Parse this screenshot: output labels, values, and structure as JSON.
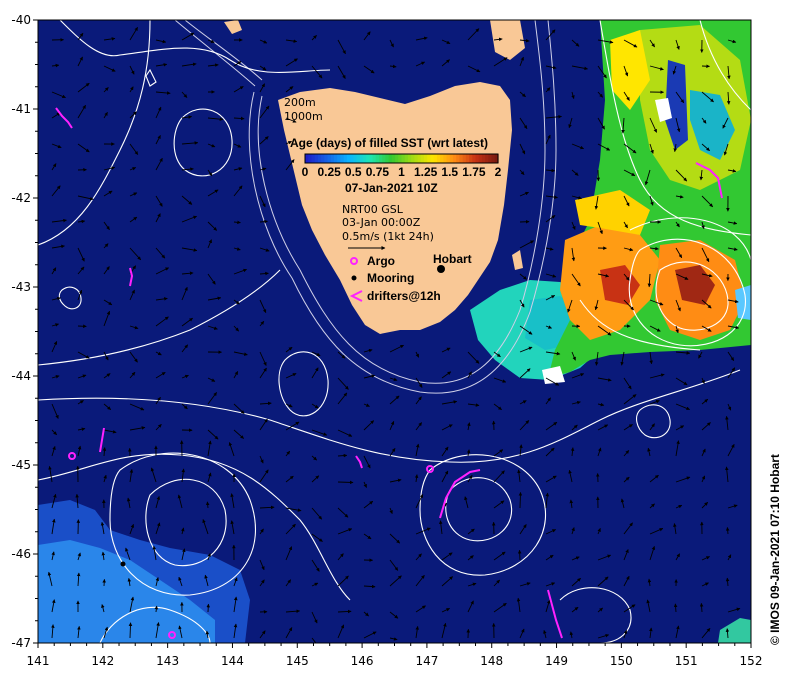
{
  "map": {
    "lon_ticks": [
      "141",
      "142",
      "143",
      "144",
      "145",
      "146",
      "147",
      "148",
      "149",
      "150",
      "151",
      "152"
    ],
    "lat_ticks": [
      "-40",
      "-41",
      "-42",
      "-43",
      "-44",
      "-45",
      "-46",
      "-47"
    ],
    "lon_range": [
      141,
      152
    ],
    "lat_range": [
      -47,
      -40
    ]
  },
  "legend": {
    "isobaths": [
      "200m",
      "1000m"
    ],
    "colorbar_title": "Age (days) of filled SST (wrt latest)",
    "colorbar_ticks": [
      "0",
      "0.25",
      "0.5",
      "0.75",
      "1",
      "1.25",
      "1.5",
      "1.75",
      "2"
    ],
    "colorbar_colors": [
      "#1e1ec8",
      "#1464e6",
      "#0ab4ff",
      "#1ee6b4",
      "#32c832",
      "#a0dc14",
      "#ffe600",
      "#ff8c14",
      "#c83214",
      "#7a1a10"
    ],
    "date": "07-Jan-2021 10Z",
    "altimetry_line1": "NRT00 GSL",
    "altimetry_line2": "03-Jan 00:00Z",
    "scale_label": "0.5m/s (1kt 24h)",
    "argo_label": "Argo",
    "mooring_label": "Mooring",
    "drifters_label": "drifters@12h",
    "city_label": "Hobart"
  },
  "credit": "© IMOS 09-Jan-2021 07:10 Hobart",
  "colors": {
    "ocean": "#0a1a7a",
    "ocean_old": "#1a5ad8",
    "ocean_older": "#2a78e6",
    "land": "#f9c896",
    "contour": "#ffffff",
    "argo": "#ff22ff",
    "drifter": "#ff22ff"
  }
}
